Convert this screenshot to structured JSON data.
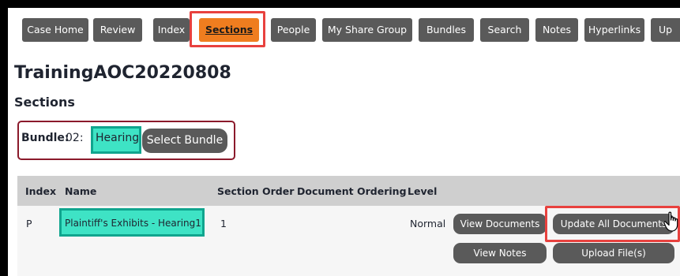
{
  "nav": {
    "items": [
      {
        "label": "Case Home"
      },
      {
        "label": "Review"
      },
      {
        "label": "Index"
      },
      {
        "label": "Sections",
        "active": true
      },
      {
        "label": "People"
      },
      {
        "label": "My Share Group"
      },
      {
        "label": "Bundles"
      },
      {
        "label": "Search"
      },
      {
        "label": "Notes"
      },
      {
        "label": "Hyperlinks"
      },
      {
        "label": "Up"
      }
    ]
  },
  "page": {
    "title": "TrainingAOC20220808",
    "subtitle": "Sections"
  },
  "bundle": {
    "label": "Bundle:",
    "code": "02:",
    "name": "Hearing",
    "select_button": "Select Bundle"
  },
  "table": {
    "headers": {
      "index": "Index",
      "name": "Name",
      "section_order": "Section Order",
      "document_ordering": "Document Ordering",
      "level": "Level"
    },
    "rows": [
      {
        "index": "P",
        "name": "Plaintiff's Exhibits - Hearing1",
        "section_order": "1",
        "level": "Normal",
        "actions": {
          "view_documents": "View Documents",
          "update_all_documents": "Update All Documents",
          "view_notes": "View Notes",
          "upload_files": "Upload File(s)"
        }
      }
    ]
  },
  "colors": {
    "nav_button": "#5a5a5a",
    "nav_active": "#ef7d1f",
    "highlight_red": "#e8413e",
    "highlight_teal": "#3ee3c5",
    "bundle_border": "#8b1a2b"
  },
  "icons": {
    "cursor": "hand-pointer-icon"
  }
}
